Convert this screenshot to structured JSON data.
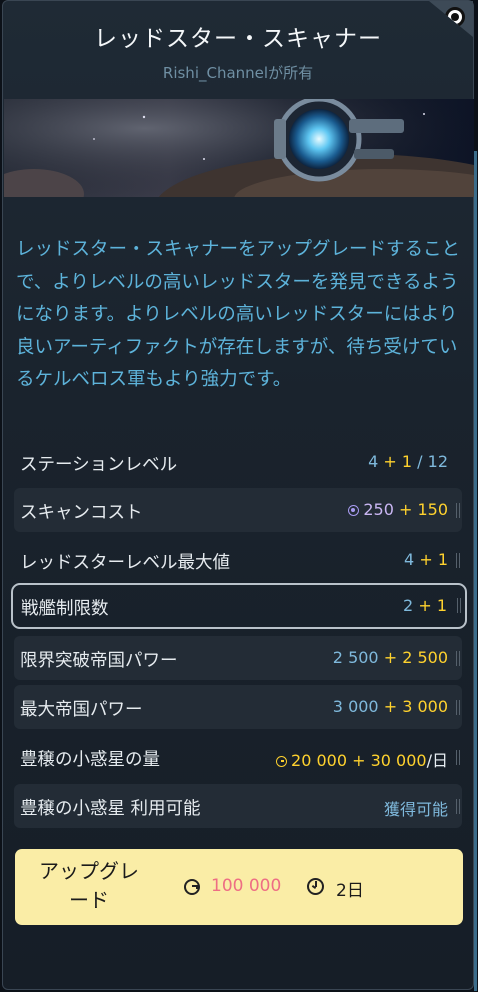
{
  "header": {
    "title": "レッドスター・スキャナー",
    "owner": "Rishi_Channelが所有"
  },
  "description": "レッドスター・スキャナーをアップグレードすることで、よりレベルの高いレッドスターを発見できるようになります。よりレベルの高いレッドスターにはより良いアーティファクトが存在しますが、待ち受けているケルベロス軍もより強力です。",
  "stats": [
    {
      "label": "ステーションレベル",
      "base": "4",
      "plus": " + ",
      "bonus": "1",
      "suffix": " / 12"
    },
    {
      "label": "スキャンコスト",
      "base": "250",
      "plus": " + ",
      "bonus": "150",
      "suffix": "",
      "icon": "scan-icon"
    },
    {
      "label": "レッドスターレベル最大値",
      "base": "4",
      "plus": " + ",
      "bonus": "1",
      "suffix": ""
    },
    {
      "label": "戦艦制限数",
      "base": "2",
      "plus": " + ",
      "bonus": "1",
      "suffix": ""
    },
    {
      "label": "限界突破帝国パワー",
      "base": "2 500",
      "plus": " + ",
      "bonus": "2 500",
      "suffix": ""
    },
    {
      "label": "最大帝国パワー",
      "base": "3 000",
      "plus": " + ",
      "bonus": "3 000",
      "suffix": ""
    },
    {
      "label": "豊穣の小惑星の量",
      "base": "20 000",
      "plus": " + ",
      "bonus": "30 000",
      "suffix": "/日",
      "icon": "asteroid-icon"
    },
    {
      "label": "豊穣の小惑星 利用可能",
      "value": "獲得可能"
    }
  ],
  "upgrade": {
    "label": "アップグレード",
    "cost": "100 000",
    "time": "2日"
  },
  "colors": {
    "accent_text": "#5db3da",
    "bonus": "#ffd22e",
    "cost_red": "#ee6e84",
    "button_bg": "#faeda6"
  }
}
